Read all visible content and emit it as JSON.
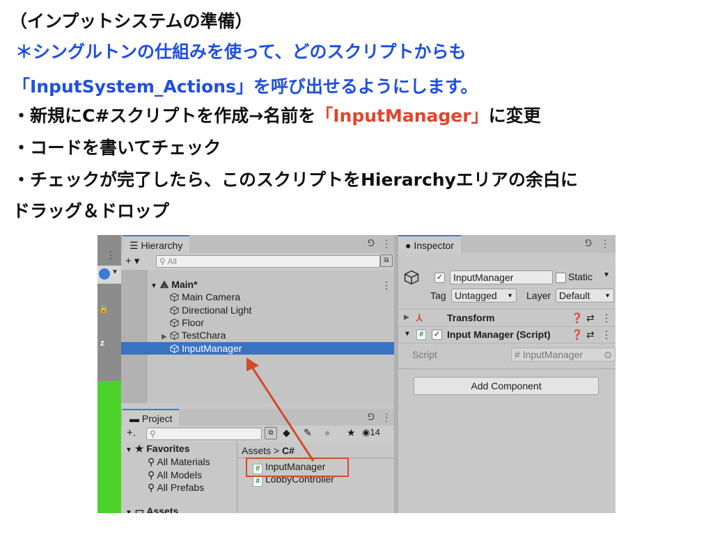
{
  "slide": {
    "line1": "（インプットシステムの準備）",
    "line2": "＊シングルトンの仕組みを使って、どのスクリプトからも",
    "line3": "「InputSystem_Actions」を呼び出せるようにします。",
    "line4_pre": "・新規にC#スクリプトを作成→名前を",
    "line4_highlight": "「InputManager」",
    "line4_post": "に変更",
    "line5": "・コードを書いてチェック",
    "line6": "・チェックが完了したら、このスクリプトをHierarchyエリアの余白に",
    "line7": "ドラッグ＆ドロップ"
  },
  "colors": {
    "blue": "#1f4fe0",
    "red": "#e0452c",
    "selection": "#3a72c4",
    "highlight_box": "#d24a2a"
  },
  "hierarchy": {
    "tab_label": "☰ Hierarchy",
    "add_label": "+ ▾",
    "search_placeholder": "All",
    "scene": "Main*",
    "items": [
      "Main Camera",
      "Directional Light",
      "Floor",
      "TestChara",
      "InputManager"
    ],
    "selected_index": 4
  },
  "project": {
    "tab_label": "Project",
    "add_label": "+.",
    "filter_count": "14",
    "favorites_label": "Favorites",
    "favorites": [
      "All Materials",
      "All Models",
      "All Prefabs"
    ],
    "assets_label": "Assets",
    "breadcrumb_root": "Assets",
    "breadcrumb_sep": ">",
    "breadcrumb_folder": "C#",
    "files": [
      "InputManager",
      "LobbyController"
    ]
  },
  "inspector": {
    "tab_label": "Inspector",
    "object_name": "InputManager",
    "static_label": "Static",
    "tag_label": "Tag",
    "tag_value": "Untagged",
    "layer_label": "Layer",
    "layer_value": "Default",
    "transform_label": "Transform",
    "component_label": "Input Manager (Script)",
    "script_field_label": "Script",
    "script_field_value": "InputManager",
    "add_component_label": "Add Component"
  },
  "icons": [
    "cube-icon",
    "lock-icon",
    "kebab-menu-icon",
    "search-icon",
    "hash-script-icon",
    "help-icon",
    "settings-sliders-icon",
    "transform-axis-icon",
    "folder-icon",
    "star-icon",
    "eye-icon",
    "info-icon"
  ]
}
